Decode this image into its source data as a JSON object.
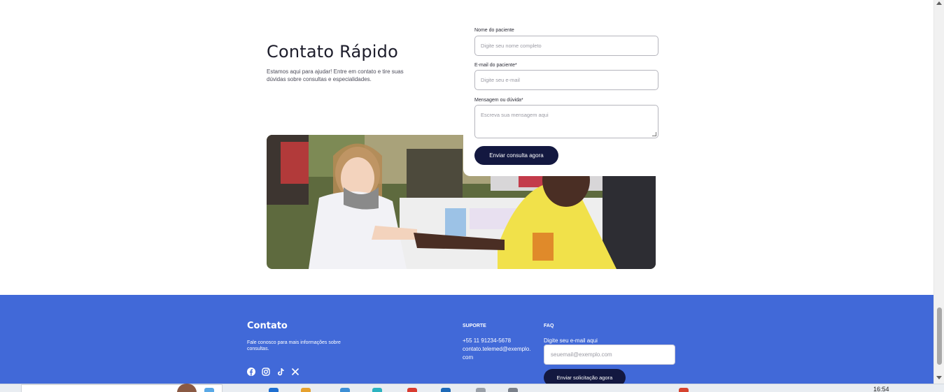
{
  "quick_contact": {
    "title": "Contato Rápido",
    "description": "Estamos aqui para ajudar! Entre em contato e tire suas dúvidas sobre consultas e especialidades."
  },
  "form": {
    "name_label": "Nome do paciente",
    "name_placeholder": "Digite seu nome completo",
    "email_label": "E-mail do paciente*",
    "email_placeholder": "Digite seu e-mail",
    "message_label": "Mensagem ou dúvida*",
    "message_placeholder": "Escreva sua mensagem aqui",
    "submit_label": "Enviar consulta agora"
  },
  "footer": {
    "title": "Contato",
    "description": "Fale conosco para mais informações sobre consultas.",
    "social_icons": [
      "facebook-icon",
      "instagram-icon",
      "tiktok-icon",
      "x-icon"
    ],
    "support_heading": "SUPORTE",
    "phone": "+55 11 91234-5678",
    "email": "contato.telemed@exemplo.com",
    "faq_heading": "FAQ",
    "faq_prompt": "Digite seu e-mail aqui",
    "faq_placeholder": "seuemail@exemplo.com",
    "faq_button": "Enviar solicitação agora",
    "background": "#4169d8",
    "button_color": "#131840"
  },
  "taskbar": {
    "clock": "16:54"
  }
}
